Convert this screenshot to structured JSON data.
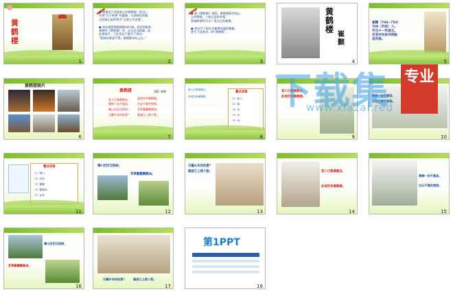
{
  "slides": [
    {
      "num": "1",
      "title": "黄鹤楼",
      "footer": "第一PPT模板网-WWW.1PPT.COM"
    },
    {
      "num": "2",
      "bullets": "●  故楼坐于武昌蛇山的黄鹤楼（武汉），\n号称“天下绝景”的盛誉，与湖南岳阳楼、\n江西滕王阁并称为“江南三大名楼”。\n\n●  李白曾登黄鹤楼题诗吟诵，但怠他看到\n崔颢的《黄鹤楼》诗，自认无法超越，此\n处便放手，只在旁边下题写了两句：\n“眼前有景道不得，崔颢题诗在上头。”"
    },
    {
      "num": "3",
      "bullets": "●  唐《黄鹤楼》说明，黄鹤楼原为蛇山\n上的黄楼，一座三层的木楼，\n登临眺望时可以一览长江的美景。\n\n●  李白为了留住对崔颢佳篇的敬重，\n便写下这首诗，称“黄鹤楼”。"
    },
    {
      "num": "4",
      "title": "黄鹤楼",
      "author": "崔颢"
    },
    {
      "num": "5",
      "bio": "崔颢（704--754）\n汴州（开封）人。\n开元十一年进士。\n天宝中为尚书司勋\n员外郎。"
    },
    {
      "num": "6",
      "title": "黄鹤楼图片"
    },
    {
      "num": "7",
      "title": "黄鹤楼",
      "sub": "【唐】崔颢",
      "lines": [
        "昔人已乘黄鹤去，",
        "此地空余黄鹤楼。",
        "黄鹤一去不复返，",
        "白云千载空悠悠。",
        "晴川历历汉阳树，",
        "芳草萋萋鹦鹉洲。",
        "日暮乡关何处是？",
        "烟波江上使人愁。"
      ]
    },
    {
      "num": "8",
      "tip1": "昔人已乘黄鹤去，",
      "tip2": "此地空余黄鹤楼。",
      "head": "重点词语",
      "items": [
        "（1）昔人：",
        "（2）乘：",
        "（3）去：",
        "（4）空：",
        "（5）余："
      ]
    },
    {
      "num": "9",
      "line1": "昔人已乘黄鹤去，",
      "line2": "此地空余黄鹤楼。"
    },
    {
      "num": "10",
      "line1": "黄鹤一去不复返，",
      "line2": "白云千载空悠悠。"
    },
    {
      "num": "11",
      "head": "重点词语",
      "items": [
        "（1）晴川：",
        "（2）历历：",
        "（3）萋萋：",
        "（4）鹦鹉洲：",
        "（5）乡关："
      ]
    },
    {
      "num": "12",
      "line1": "晴川历历汉阳树，",
      "line2": "芳草萋萋鹦鹉洲。"
    },
    {
      "num": "13",
      "line1": "日暮乡关何处是？",
      "line2": "烟波江上使人愁。"
    },
    {
      "num": "14",
      "line1": "昔人已乘黄鹤去，",
      "line2": "此地空余黄鹤楼。"
    },
    {
      "num": "15",
      "line1": "黄鹤一去不复返，",
      "line2": "白云千载空悠悠。"
    },
    {
      "num": "16",
      "line1": "晴川历历汉阳树，",
      "line2": "芳草萋萋鹦鹉洲。"
    },
    {
      "num": "17",
      "line1": "日暮乡关何处是？",
      "line2": "烟波江上使人愁。"
    },
    {
      "num": "18",
      "logo": "第1PPT"
    }
  ],
  "watermark": {
    "main": "下载集",
    "url": "www.xiazai.red",
    "badge": "专业"
  }
}
